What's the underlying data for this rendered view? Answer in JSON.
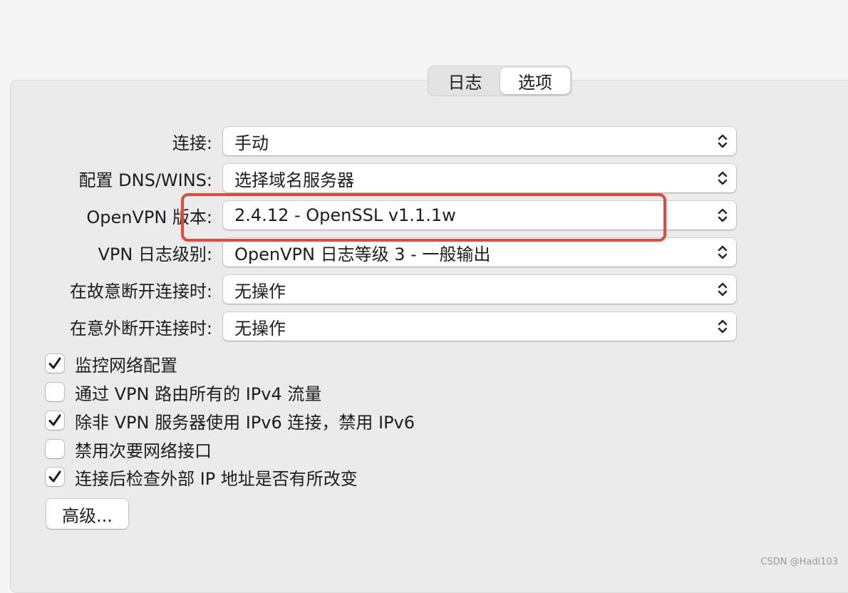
{
  "tabs": [
    {
      "label": "日志",
      "selected": false
    },
    {
      "label": "选项",
      "selected": true
    }
  ],
  "settings": [
    {
      "label": "连接:",
      "value": "手动"
    },
    {
      "label": "配置 DNS/WINS:",
      "value": "选择域名服务器"
    },
    {
      "label": "OpenVPN 版本:",
      "value": "2.4.12 - OpenSSL v1.1.1w"
    },
    {
      "label": "VPN 日志级别:",
      "value": "OpenVPN 日志等级 3 - 一般输出"
    },
    {
      "label": "在故意断开连接时:",
      "value": "无操作"
    },
    {
      "label": "在意外断开连接时:",
      "value": "无操作"
    }
  ],
  "checkboxes": [
    {
      "label": "监控网络配置",
      "checked": true
    },
    {
      "label": "通过 VPN 路由所有的 IPv4 流量",
      "checked": false
    },
    {
      "label": "除非 VPN 服务器使用 IPv6 连接，禁用 IPv6",
      "checked": true
    },
    {
      "label": "禁用次要网络接口",
      "checked": false
    },
    {
      "label": "连接后检查外部 IP 地址是否有所改变",
      "checked": true
    }
  ],
  "advanced_button": "高级...",
  "watermark": "CSDN @Hadi103",
  "colors": {
    "highlight": "#e24a3b",
    "panel_bg": "#ebebeb"
  }
}
